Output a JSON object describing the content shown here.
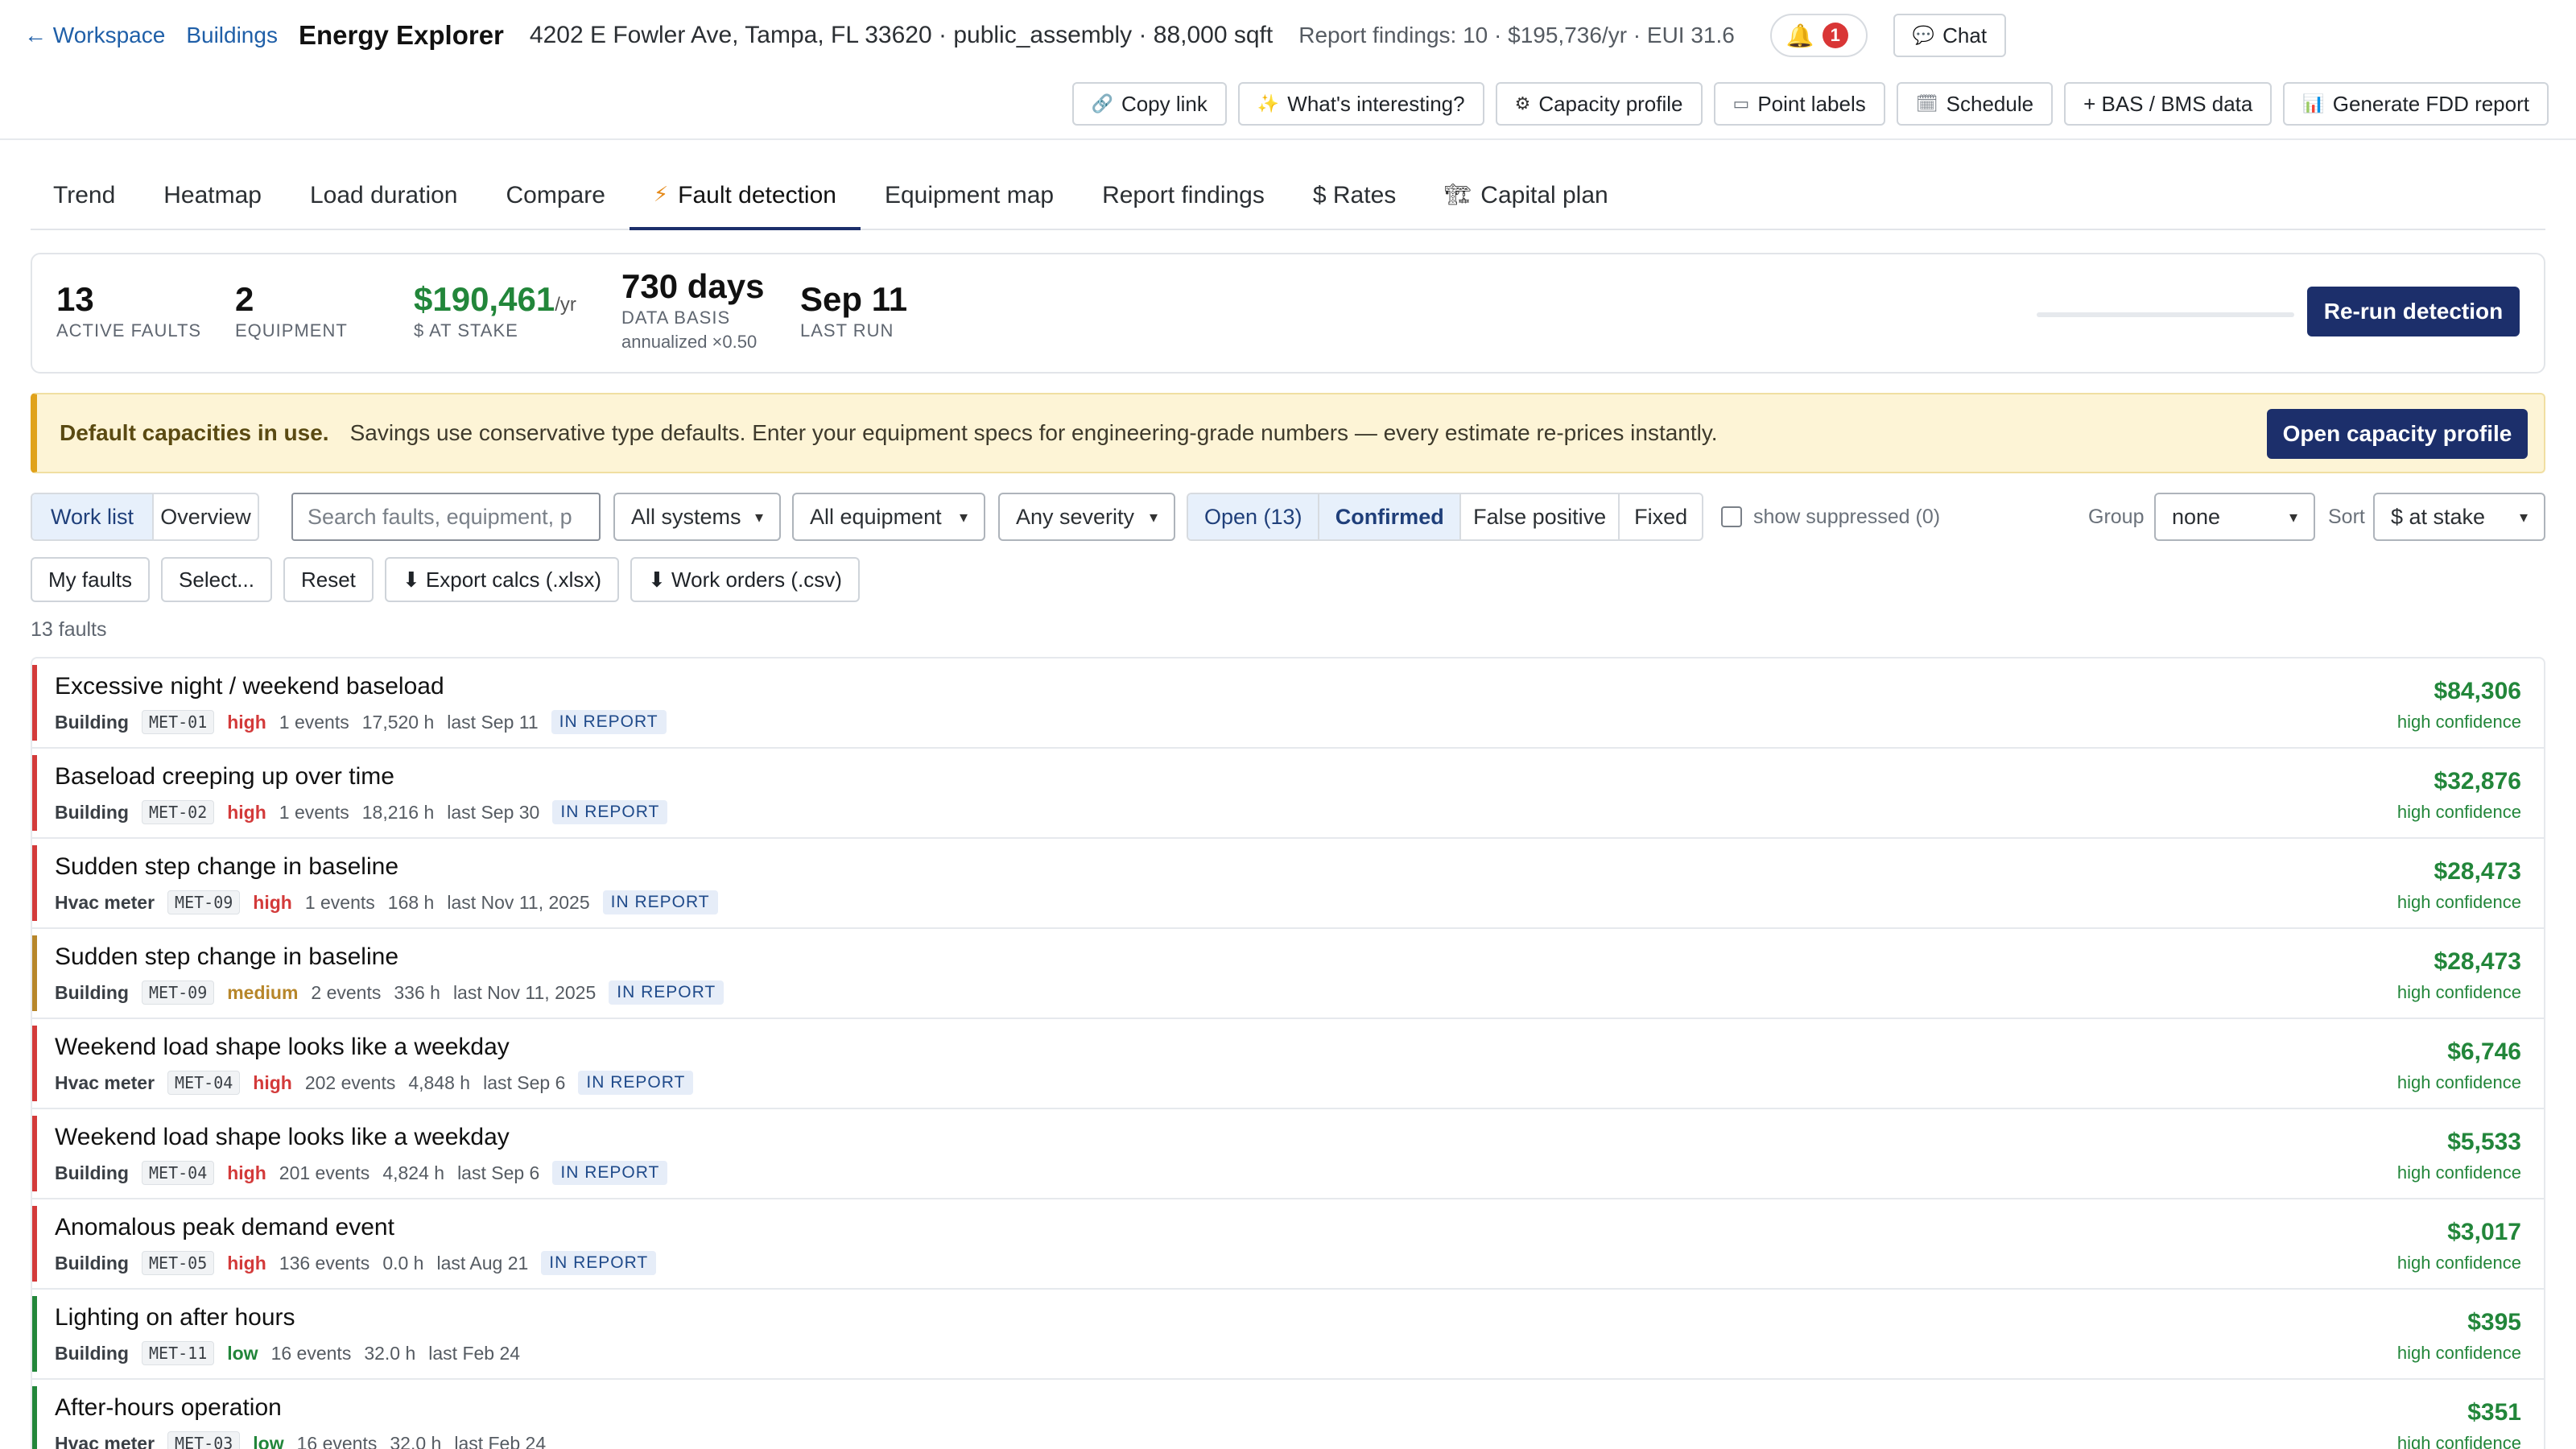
{
  "header": {
    "back_label": "← Workspace",
    "buildings_label": "Buildings",
    "app_title": "Energy Explorer",
    "building_summary": "4202 E Fowler Ave, Tampa, FL 33620 · public_assembly · 88,000 sqft",
    "findings_summary": "Report findings: 10 · $195,736/yr · EUI 31.6",
    "notification_count": "1",
    "chat_label": "Chat",
    "toolbar": {
      "copy_link": "Copy link",
      "whats_interesting": "What's interesting?",
      "capacity_profile": "Capacity profile",
      "point_labels": "Point labels",
      "schedule": "Schedule",
      "bas_data": "+ BAS / BMS data",
      "generate_report": "Generate FDD report"
    }
  },
  "tabs": [
    "Trend",
    "Heatmap",
    "Load duration",
    "Compare",
    "Fault detection",
    "Equipment map",
    "Report findings",
    "$ Rates",
    "Capital plan"
  ],
  "active_tab": "Fault detection",
  "stats": {
    "active_faults": {
      "value": "13",
      "label": "ACTIVE FAULTS"
    },
    "equipment": {
      "value": "2",
      "label": "EQUIPMENT"
    },
    "at_stake": {
      "value": "$190,461",
      "unit": "/yr",
      "label": "$ AT STAKE"
    },
    "data_basis": {
      "value": "730 days",
      "label": "DATA BASIS",
      "sub": "annualized ×0.50"
    },
    "last_run": {
      "value": "Sep 11",
      "label": "LAST RUN"
    },
    "rerun_label": "Re-run detection"
  },
  "banner": {
    "title": "Default capacities in use.",
    "text": "Savings use conservative type defaults. Enter your equipment specs for engineering-grade numbers — every estimate re-prices instantly.",
    "button_label": "Open capacity profile"
  },
  "filters": {
    "view_tabs": [
      "Work list",
      "Overview"
    ],
    "search_placeholder": "Search faults, equipment, p",
    "systems": "All systems",
    "equipment": "All equipment",
    "severity": "Any severity",
    "status_tabs": [
      "Open (13)",
      "Confirmed",
      "False positive",
      "Fixed"
    ],
    "show_suppressed": "show suppressed (0)",
    "group_label": "Group",
    "group_value": "none",
    "sort_label": "Sort",
    "sort_value": "$ at stake"
  },
  "actions": {
    "my_faults": "My faults",
    "select": "Select...",
    "reset": "Reset",
    "export_calcs": "⬇ Export calcs (.xlsx)",
    "work_orders": "⬇ Work orders (.csv)"
  },
  "fault_count_label": "13 faults",
  "faults": [
    {
      "title": "Excessive night / weekend baseload",
      "kind": "Building",
      "code": "MET-01",
      "severity": "high",
      "events": "1 events",
      "hours": "17,520 h",
      "last": "last Sep 11",
      "tag": "IN REPORT",
      "amount": "$84,306",
      "confidence": "high confidence"
    },
    {
      "title": "Baseload creeping up over time",
      "kind": "Building",
      "code": "MET-02",
      "severity": "high",
      "events": "1 events",
      "hours": "18,216 h",
      "last": "last Sep 30",
      "tag": "IN REPORT",
      "amount": "$32,876",
      "confidence": "high confidence"
    },
    {
      "title": "Sudden step change in baseline",
      "kind": "Hvac meter",
      "code": "MET-09",
      "severity": "high",
      "events": "1 events",
      "hours": "168 h",
      "last": "last Nov 11, 2025",
      "tag": "IN REPORT",
      "amount": "$28,473",
      "confidence": "high confidence"
    },
    {
      "title": "Sudden step change in baseline",
      "kind": "Building",
      "code": "MET-09",
      "severity": "medium",
      "events": "2 events",
      "hours": "336 h",
      "last": "last Nov 11, 2025",
      "tag": "IN REPORT",
      "amount": "$28,473",
      "confidence": "high confidence"
    },
    {
      "title": "Weekend load shape looks like a weekday",
      "kind": "Hvac meter",
      "code": "MET-04",
      "severity": "high",
      "events": "202 events",
      "hours": "4,848 h",
      "last": "last Sep 6",
      "tag": "IN REPORT",
      "amount": "$6,746",
      "confidence": "high confidence"
    },
    {
      "title": "Weekend load shape looks like a weekday",
      "kind": "Building",
      "code": "MET-04",
      "severity": "high",
      "events": "201 events",
      "hours": "4,824 h",
      "last": "last Sep 6",
      "tag": "IN REPORT",
      "amount": "$5,533",
      "confidence": "high confidence"
    },
    {
      "title": "Anomalous peak demand event",
      "kind": "Building",
      "code": "MET-05",
      "severity": "high",
      "events": "136 events",
      "hours": "0.0 h",
      "last": "last Aug 21",
      "tag": "IN REPORT",
      "amount": "$3,017",
      "confidence": "high confidence"
    },
    {
      "title": "Lighting on after hours",
      "kind": "Building",
      "code": "MET-11",
      "severity": "low",
      "events": "16 events",
      "hours": "32.0 h",
      "last": "last Feb 24",
      "tag": "",
      "amount": "$395",
      "confidence": "high confidence"
    },
    {
      "title": "After-hours operation",
      "kind": "Hvac meter",
      "code": "MET-03",
      "severity": "low",
      "events": "16 events",
      "hours": "32.0 h",
      "last": "last Feb 24",
      "tag": "",
      "amount": "$351",
      "confidence": "high confidence"
    }
  ],
  "colors": {
    "primary": "#1c2f6b",
    "money_green": "#22863a",
    "severity_high": "#d33a3a",
    "severity_medium": "#b7862a",
    "severity_low": "#22863a",
    "banner_bg": "#fdf4d6"
  }
}
